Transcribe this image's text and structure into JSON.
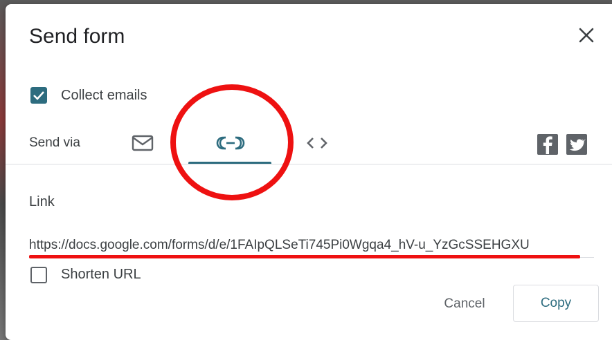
{
  "dialog": {
    "title": "Send form",
    "collect_emails": {
      "label": "Collect emails",
      "checked": true
    },
    "send_via": {
      "label": "Send via",
      "tabs": [
        {
          "name": "email",
          "icon": "mail-icon",
          "active": false
        },
        {
          "name": "link",
          "icon": "link-icon",
          "active": true
        },
        {
          "name": "embed",
          "icon": "code-icon",
          "active": false
        }
      ],
      "share": [
        {
          "name": "facebook",
          "icon": "facebook-icon"
        },
        {
          "name": "twitter",
          "icon": "twitter-icon"
        }
      ]
    },
    "link_section": {
      "heading": "Link",
      "url": "https://docs.google.com/forms/d/e/1FAIpQLSeTi745Pi0Wgqa4_hV-u_YzGcSSEHGXU",
      "shorten_url": {
        "label": "Shorten URL",
        "checked": false
      }
    },
    "buttons": {
      "cancel": "Cancel",
      "copy": "Copy"
    }
  },
  "colors": {
    "accent": "#2d6c7f",
    "annotation": "#ee1111",
    "text": "#3c4043",
    "icon_gray": "#5f6368"
  }
}
